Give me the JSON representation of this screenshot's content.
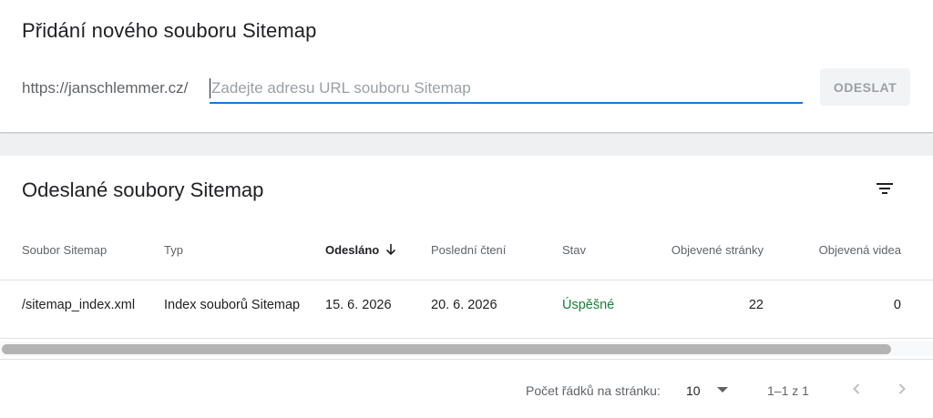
{
  "add_sitemap": {
    "title": "Přidání nového souboru Sitemap",
    "url_prefix": "https://janschlemmer.cz/",
    "input_value": "",
    "input_placeholder": "Zadejte adresu URL souboru Sitemap",
    "submit_label": "ODESLAT"
  },
  "submitted": {
    "title": "Odeslané soubory Sitemap",
    "filter_icon": "filter-list-icon",
    "columns": [
      "Soubor Sitemap",
      "Typ",
      "Odesláno",
      "Poslední čtení",
      "Stav",
      "Objevené stránky",
      "Objevená videa"
    ],
    "sorted_column": "Odesláno",
    "sort_direction_icon": "arrow-down-icon",
    "rows": [
      {
        "file": "/sitemap_index.xml",
        "type": "Index souborů Sitemap",
        "submitted": "15. 6. 2026",
        "last_read": "20. 6. 2026",
        "status": "Úspěšné",
        "pages": "22",
        "videos": "0"
      }
    ],
    "colors": {
      "success": "#188038",
      "accent": "#1a73e8"
    }
  },
  "pagination": {
    "rows_per_page_label": "Počet řádků na stránku:",
    "rows_per_page_value": "10",
    "range": "1–1 z 1",
    "prev_icon": "chevron-left-icon",
    "next_icon": "chevron-right-icon"
  }
}
